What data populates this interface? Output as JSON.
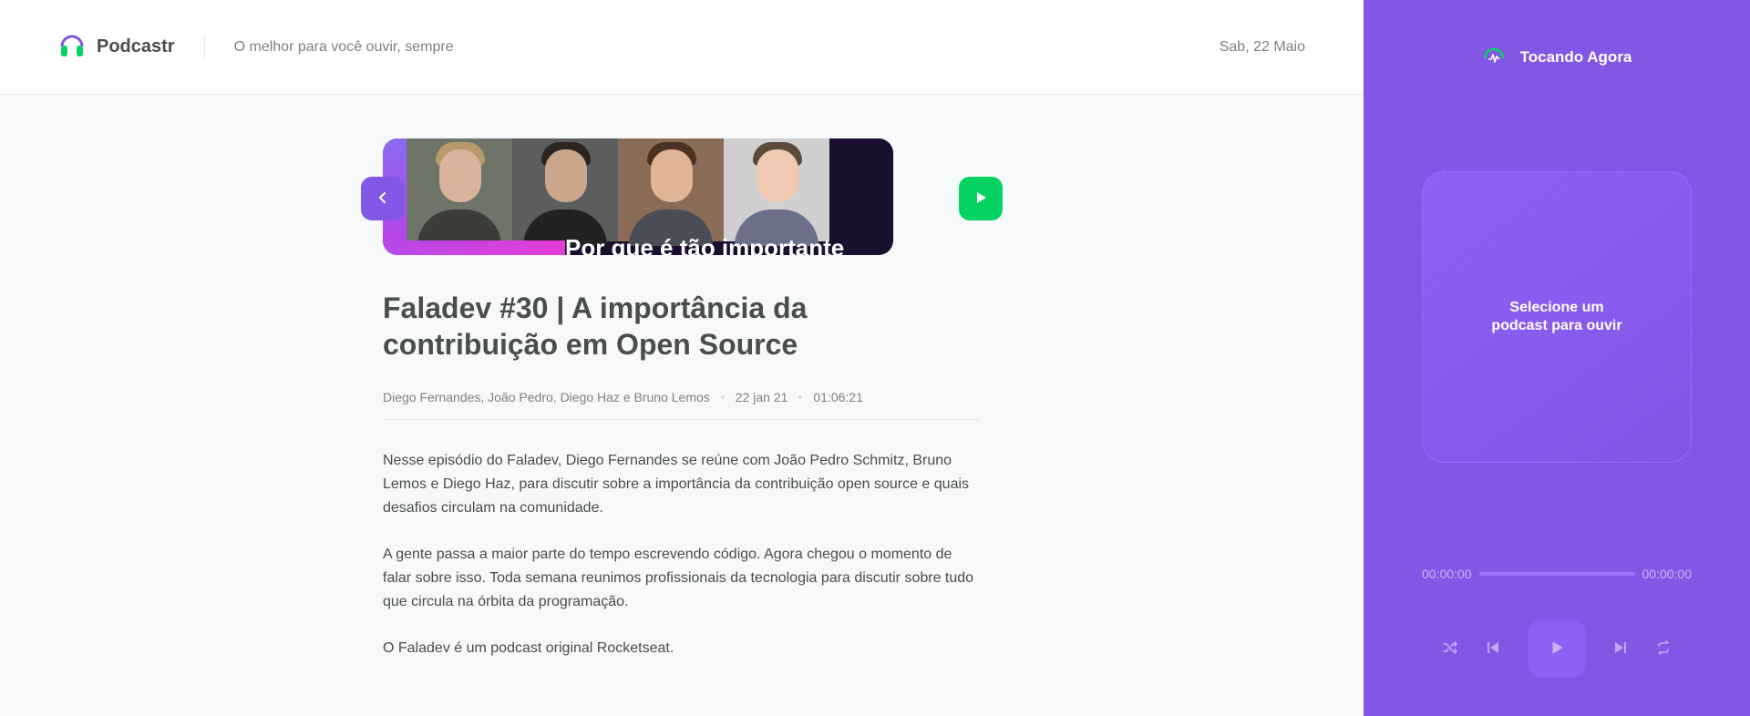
{
  "header": {
    "logo_text": "Podcastr",
    "tagline": "O melhor para você ouvir, sempre",
    "date": "Sab, 22 Maio"
  },
  "episode": {
    "thumbnail_caption": "Por que é tão importante",
    "title": "Faladev #30 | A importância da contribuição em Open Source",
    "members": "Diego Fernandes, João Pedro, Diego Haz e Bruno Lemos",
    "published_at": "22 jan 21",
    "duration": "01:06:21",
    "description": [
      "Nesse episódio do Faladev, Diego Fernandes se reúne com João Pedro Schmitz, Bruno Lemos e Diego Haz, para discutir sobre a importância da contribuição open source e quais desafios circulam na comunidade.",
      "A gente passa a maior parte do tempo escrevendo código. Agora chegou o momento de falar sobre isso. Toda semana reunimos profissionais da tecnologia para discutir sobre tudo que circula na órbita da programação.",
      "O Faladev é um podcast original Rocketseat."
    ]
  },
  "player": {
    "header": "Tocando Agora",
    "empty_message_line1": "Selecione um",
    "empty_message_line2": "podcast para ouvir",
    "current_time": "00:00:00",
    "total_time": "00:00:00",
    "progress_fraction": 0,
    "controls": [
      "shuffle-icon",
      "previous-icon",
      "play-icon",
      "next-icon",
      "repeat-icon"
    ]
  },
  "colors": {
    "purple": "#8257E5",
    "green": "#04D361",
    "text": "#494D4B",
    "muted": "#808080"
  }
}
